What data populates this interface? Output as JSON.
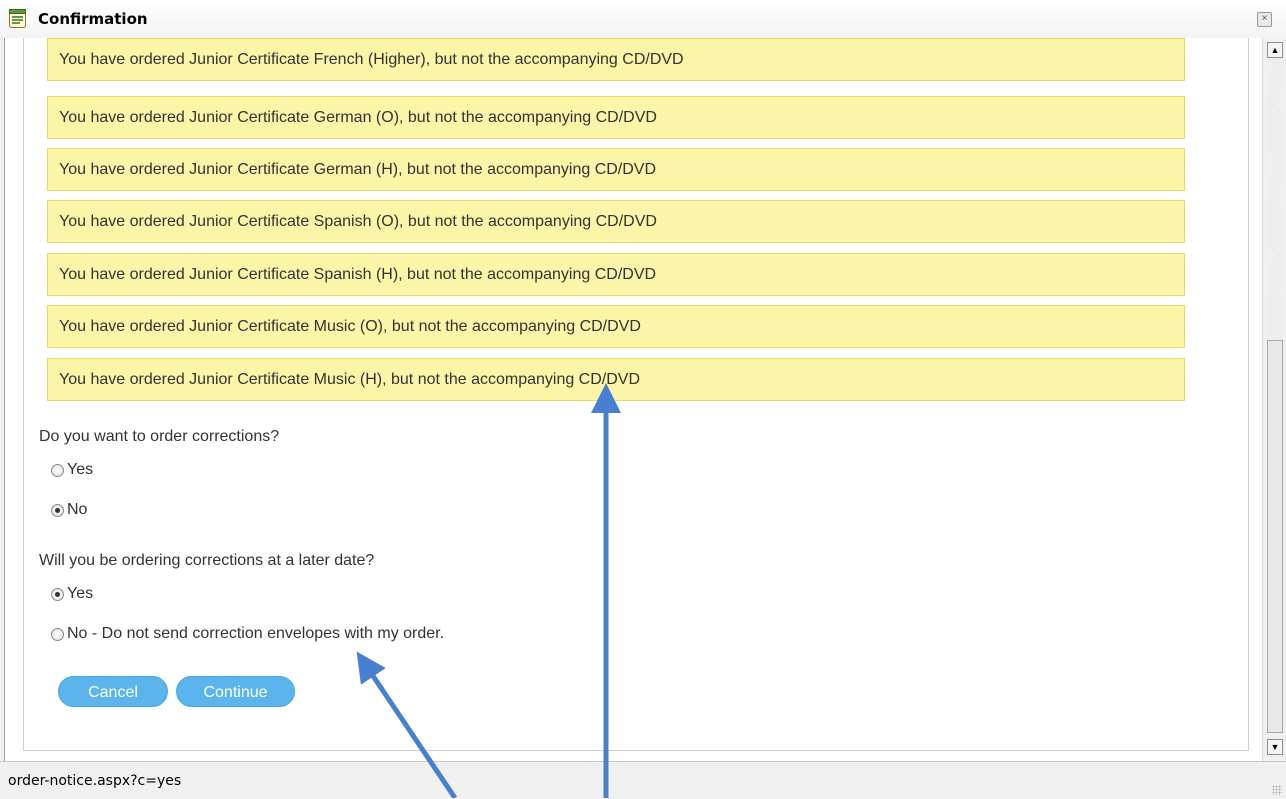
{
  "window": {
    "title": "Confirmation",
    "close_glyph": "×"
  },
  "notices": [
    "You have ordered Junior Certificate French (Higher), but not the accompanying CD/DVD",
    "You have ordered Junior Certificate German (O), but not the accompanying CD/DVD",
    "You have ordered Junior Certificate German (H), but not the accompanying CD/DVD",
    "You have ordered Junior Certificate Spanish (O), but not the accompanying CD/DVD",
    "You have ordered Junior Certificate Spanish (H), but not the accompanying CD/DVD",
    "You have ordered Junior Certificate Music (O), but not the accompanying CD/DVD",
    "You have ordered Junior Certificate Music (H), but not the accompanying CD/DVD"
  ],
  "question1": {
    "label": "Do you want to order corrections?",
    "options": [
      {
        "label": "Yes",
        "selected": false
      },
      {
        "label": "No",
        "selected": true
      }
    ]
  },
  "question2": {
    "label": "Will you be ordering corrections at a later date?",
    "options": [
      {
        "label": "Yes",
        "selected": true
      },
      {
        "label": "No - Do not send correction envelopes with my order.",
        "selected": false
      }
    ]
  },
  "buttons": {
    "cancel": "Cancel",
    "continue": "Continue"
  },
  "scrollbar": {
    "up_glyph": "▲",
    "down_glyph": "▼"
  },
  "status": {
    "url": "order-notice.aspx?c=yes"
  },
  "colors": {
    "notice_bg": "#fbf5a8",
    "notice_border": "#e7d86c",
    "button_bg": "#5bb5ec",
    "annotation_arrow": "#4a7fd0"
  },
  "icons": {
    "title": "document-list-icon",
    "close": "close-icon"
  }
}
